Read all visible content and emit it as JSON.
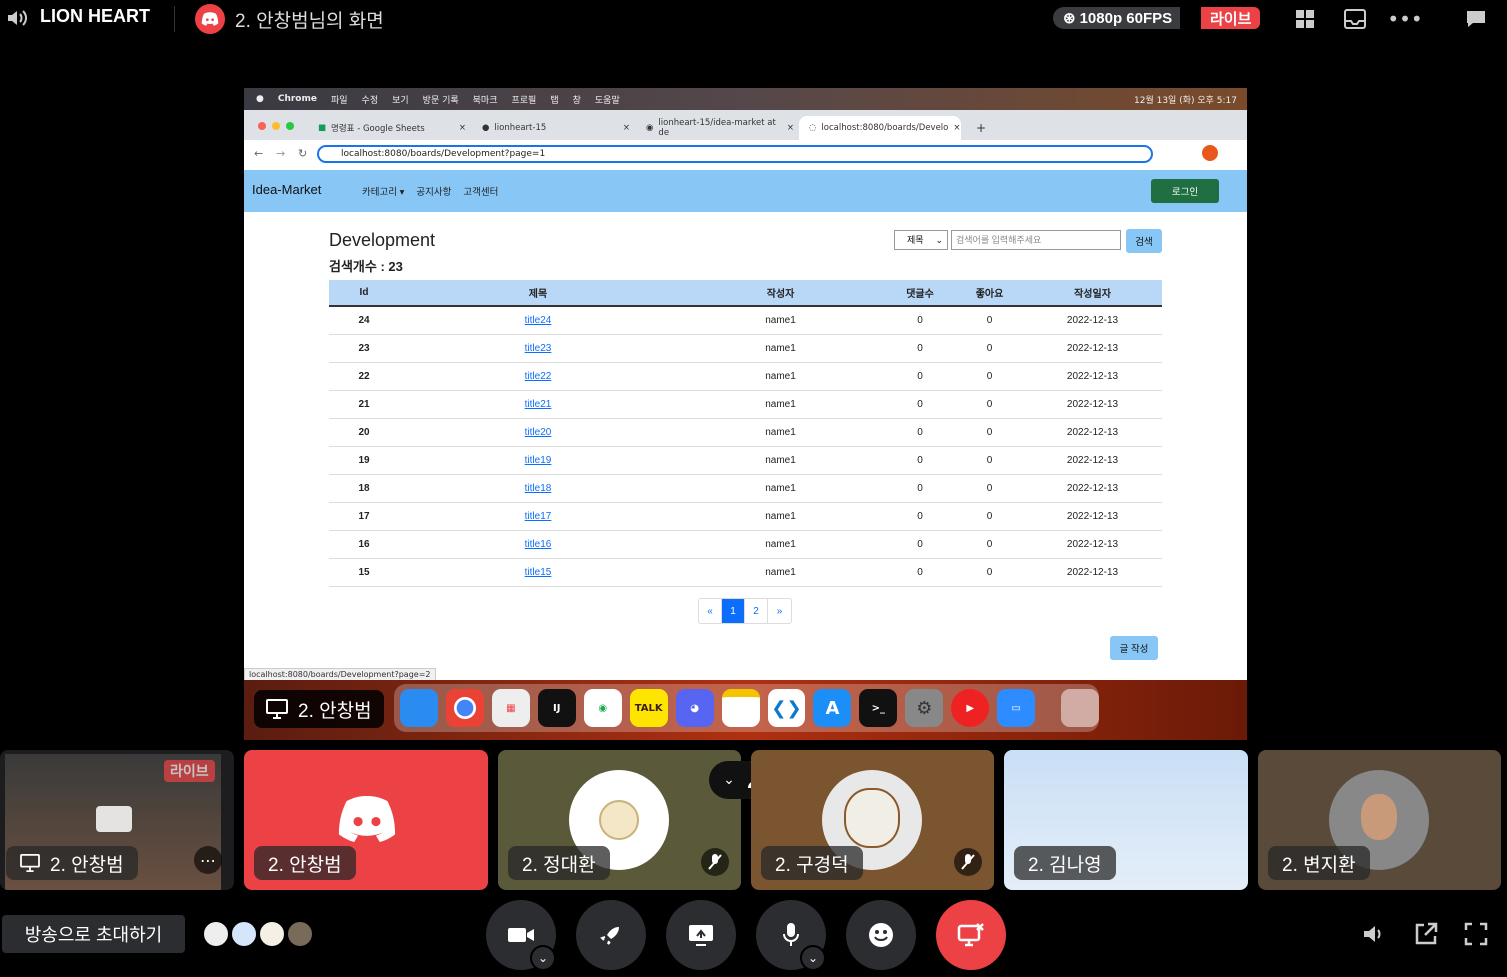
{
  "topbar": {
    "server_name": "LION HEART",
    "channel_title": "2. 안창범님의 화면",
    "quality": "1080p 60FPS",
    "live": "라이브"
  },
  "mac_menu": [
    "Chrome",
    "파일",
    "수정",
    "보기",
    "방문 기록",
    "북마크",
    "프로필",
    "탭",
    "창",
    "도움말"
  ],
  "mac_clock": "12월 13일 (화) 오후 5:17",
  "chrome": {
    "tabs": [
      "명령표 - Google Sheets",
      "lionheart-15",
      "lionheart-15/idea-market at de",
      "localhost:8080/boards/Develo"
    ],
    "url": "localhost:8080/boards/Development?page=1",
    "status_url": "localhost:8080/boards/Development?page=2"
  },
  "site": {
    "brand": "Idea-Market",
    "nav": [
      "카테고리 ▾",
      "공지사항",
      "고객센터"
    ],
    "login": "로그인",
    "heading": "Development",
    "count": "검색개수 : 23",
    "search_select": "제목",
    "search_placeholder": "검색어를 입력해주세요",
    "search_button": "검색",
    "columns": [
      "Id",
      "제목",
      "작성자",
      "댓글수",
      "좋아요",
      "작성일자"
    ],
    "rows": [
      [
        "24",
        "title24",
        "name1",
        "0",
        "0",
        "2022-12-13"
      ],
      [
        "23",
        "title23",
        "name1",
        "0",
        "0",
        "2022-12-13"
      ],
      [
        "22",
        "title22",
        "name1",
        "0",
        "0",
        "2022-12-13"
      ],
      [
        "21",
        "title21",
        "name1",
        "0",
        "0",
        "2022-12-13"
      ],
      [
        "20",
        "title20",
        "name1",
        "0",
        "0",
        "2022-12-13"
      ],
      [
        "19",
        "title19",
        "name1",
        "0",
        "0",
        "2022-12-13"
      ],
      [
        "18",
        "title18",
        "name1",
        "0",
        "0",
        "2022-12-13"
      ],
      [
        "17",
        "title17",
        "name1",
        "0",
        "0",
        "2022-12-13"
      ],
      [
        "16",
        "title16",
        "name1",
        "0",
        "0",
        "2022-12-13"
      ],
      [
        "15",
        "title15",
        "name1",
        "0",
        "0",
        "2022-12-13"
      ]
    ],
    "pager": [
      "«",
      "1",
      "2",
      "»"
    ],
    "write": "글 작성"
  },
  "share_label": "2. 안창범",
  "tiles": [
    {
      "name": "2. 안창범",
      "live": "라이브"
    },
    {
      "name": "2. 안창범"
    },
    {
      "name": "2. 정대환"
    },
    {
      "name": "2. 구경덕"
    },
    {
      "name": "2. 김나영"
    },
    {
      "name": "2. 변지환"
    }
  ],
  "invite": "방송으로 초대하기",
  "colors": {
    "discord_red": "#ed4245",
    "nav_blue": "#87c6f5",
    "login_green": "#1f6f42"
  }
}
